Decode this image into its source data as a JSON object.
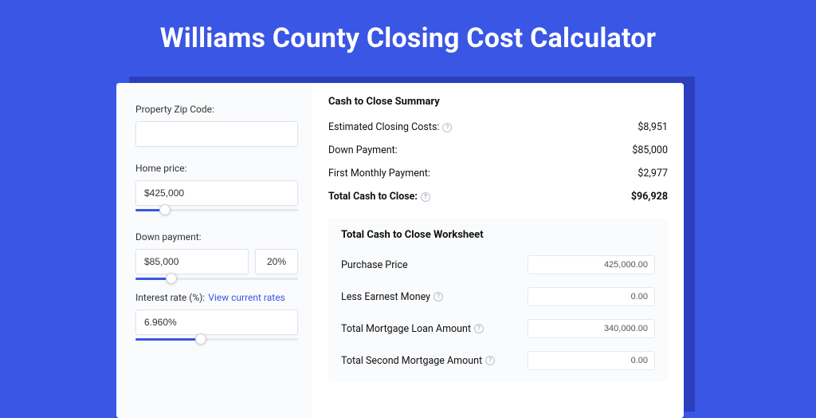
{
  "page": {
    "title": "Williams County Closing Cost Calculator"
  },
  "inputs": {
    "zip_label": "Property Zip Code:",
    "zip_value": "",
    "home_price_label": "Home price:",
    "home_price_value": "$425,000",
    "home_price_fill_pct": 18,
    "down_payment_label": "Down payment:",
    "down_payment_value": "$85,000",
    "down_payment_pct_value": "20%",
    "down_payment_fill_pct": 22,
    "interest_rate_label": "Interest rate (%):",
    "interest_rate_link": "View current rates",
    "interest_rate_value": "6.960%",
    "interest_rate_fill_pct": 40
  },
  "summary": {
    "title": "Cash to Close Summary",
    "rows": [
      {
        "label": "Estimated Closing Costs:",
        "help": true,
        "value": "$8,951"
      },
      {
        "label": "Down Payment:",
        "help": false,
        "value": "$85,000"
      },
      {
        "label": "First Monthly Payment:",
        "help": false,
        "value": "$2,977"
      }
    ],
    "total_label": "Total Cash to Close:",
    "total_value": "$96,928"
  },
  "worksheet": {
    "title": "Total Cash to Close Worksheet",
    "rows": [
      {
        "label": "Purchase Price",
        "help": false,
        "value": "425,000.00"
      },
      {
        "label": "Less Earnest Money",
        "help": true,
        "value": "0.00"
      },
      {
        "label": "Total Mortgage Loan Amount",
        "help": true,
        "value": "340,000.00"
      },
      {
        "label": "Total Second Mortgage Amount",
        "help": true,
        "value": "0.00"
      }
    ]
  }
}
